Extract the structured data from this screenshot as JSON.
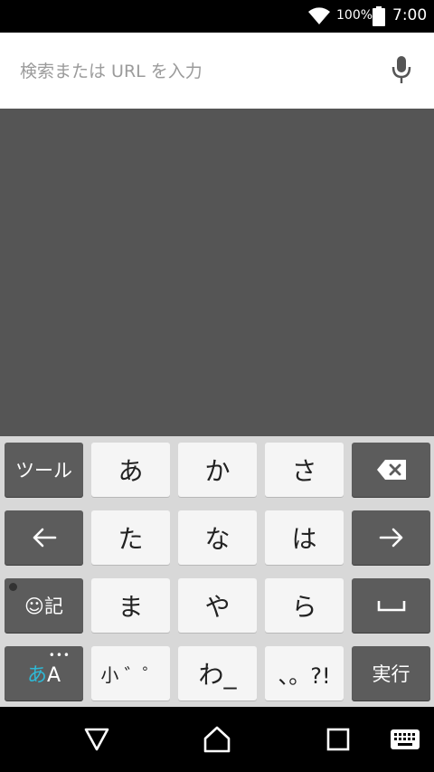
{
  "status_bar": {
    "battery_percent": "100%",
    "time": "7:00"
  },
  "search": {
    "placeholder": "検索または URL を入力"
  },
  "keyboard": {
    "rows": [
      [
        {
          "label": "ツール",
          "style": "dark",
          "name": "tool-key"
        },
        {
          "label": "あ",
          "style": "light",
          "name": "key-a"
        },
        {
          "label": "か",
          "style": "light",
          "name": "key-ka"
        },
        {
          "label": "さ",
          "style": "light",
          "name": "key-sa"
        },
        {
          "label": "",
          "style": "dark",
          "icon": "backspace-icon",
          "name": "backspace-key"
        }
      ],
      [
        {
          "label": "",
          "style": "dark",
          "icon": "arrow-left-icon",
          "name": "cursor-left-key"
        },
        {
          "label": "た",
          "style": "light",
          "name": "key-ta"
        },
        {
          "label": "な",
          "style": "light",
          "name": "key-na"
        },
        {
          "label": "は",
          "style": "light",
          "name": "key-ha"
        },
        {
          "label": "",
          "style": "dark",
          "icon": "arrow-right-icon",
          "name": "cursor-right-key"
        }
      ],
      [
        {
          "label": "☺記",
          "style": "dark",
          "name": "symbol-key"
        },
        {
          "label": "ま",
          "style": "light",
          "name": "key-ma"
        },
        {
          "label": "や",
          "style": "light",
          "name": "key-ya"
        },
        {
          "label": "ら",
          "style": "light",
          "name": "key-ra"
        },
        {
          "label": "",
          "style": "dark",
          "icon": "space-icon",
          "name": "space-key"
        }
      ],
      [
        {
          "label": "あA",
          "style": "dark",
          "name": "input-mode-key"
        },
        {
          "label": "小 ゛゜",
          "style": "light",
          "name": "small-dakuten-key"
        },
        {
          "label": "わ_",
          "style": "light",
          "name": "key-wa"
        },
        {
          "label": "、。?!",
          "style": "light",
          "name": "punctuation-key"
        },
        {
          "label": "実行",
          "style": "dark",
          "name": "enter-key"
        }
      ]
    ]
  },
  "nav_bar": {
    "icons": [
      "back-icon",
      "home-icon",
      "recents-icon",
      "keyboard-icon"
    ]
  }
}
